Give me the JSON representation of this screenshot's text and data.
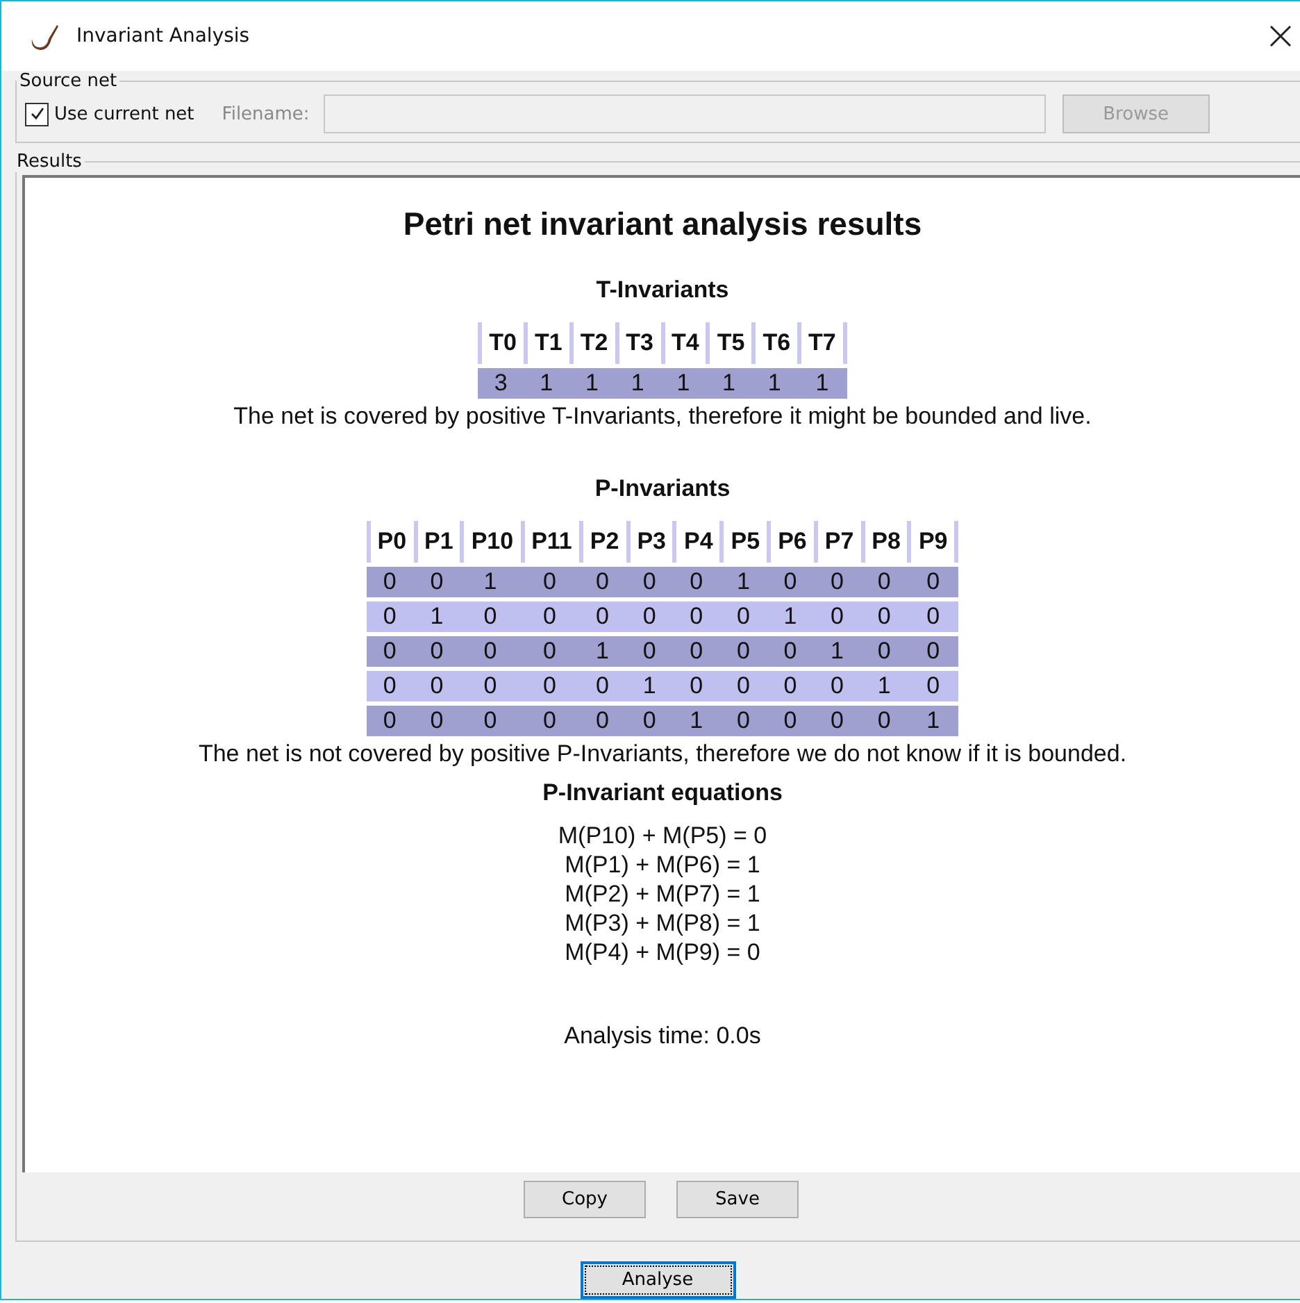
{
  "window": {
    "title": "Invariant Analysis"
  },
  "source_net": {
    "legend": "Source net",
    "use_current_net": {
      "label": "Use current net",
      "checked": true
    },
    "filename": {
      "label": "Filename:",
      "disabled": true
    },
    "browse": {
      "label": "Browse",
      "disabled": true
    }
  },
  "results": {
    "legend": "Results",
    "heading": "Petri net invariant analysis results",
    "t_invariants": {
      "title": "T-Invariants",
      "columns": [
        "T0",
        "T1",
        "T2",
        "T3",
        "T4",
        "T5",
        "T6",
        "T7"
      ],
      "rows": [
        [
          "3",
          "1",
          "1",
          "1",
          "1",
          "1",
          "1",
          "1"
        ]
      ],
      "message": "The net is covered by positive T-Invariants, therefore it might be bounded and live."
    },
    "p_invariants": {
      "title": "P-Invariants",
      "columns": [
        "P0",
        "P1",
        "P10",
        "P11",
        "P2",
        "P3",
        "P4",
        "P5",
        "P6",
        "P7",
        "P8",
        "P9"
      ],
      "rows": [
        [
          "0",
          "0",
          "1",
          "0",
          "0",
          "0",
          "0",
          "1",
          "0",
          "0",
          "0",
          "0"
        ],
        [
          "0",
          "1",
          "0",
          "0",
          "0",
          "0",
          "0",
          "0",
          "1",
          "0",
          "0",
          "0"
        ],
        [
          "0",
          "0",
          "0",
          "0",
          "1",
          "0",
          "0",
          "0",
          "0",
          "1",
          "0",
          "0"
        ],
        [
          "0",
          "0",
          "0",
          "0",
          "0",
          "1",
          "0",
          "0",
          "0",
          "0",
          "1",
          "0"
        ],
        [
          "0",
          "0",
          "0",
          "0",
          "0",
          "0",
          "1",
          "0",
          "0",
          "0",
          "0",
          "1"
        ]
      ],
      "message": "The net is not covered by positive P-Invariants, therefore we do not know if it is bounded."
    },
    "equations": {
      "title": "P-Invariant equations",
      "lines": [
        "M(P10) + M(P5) = 0",
        "M(P1) + M(P6) = 1",
        "M(P2) + M(P7) = 1",
        "M(P3) + M(P8) = 1",
        "M(P4) + M(P9) = 0"
      ]
    },
    "analysis_time": "Analysis time: 0.0s",
    "buttons": [
      "Copy",
      "Save"
    ]
  },
  "analyse_button": {
    "label": "Analyse",
    "focused": true
  }
}
